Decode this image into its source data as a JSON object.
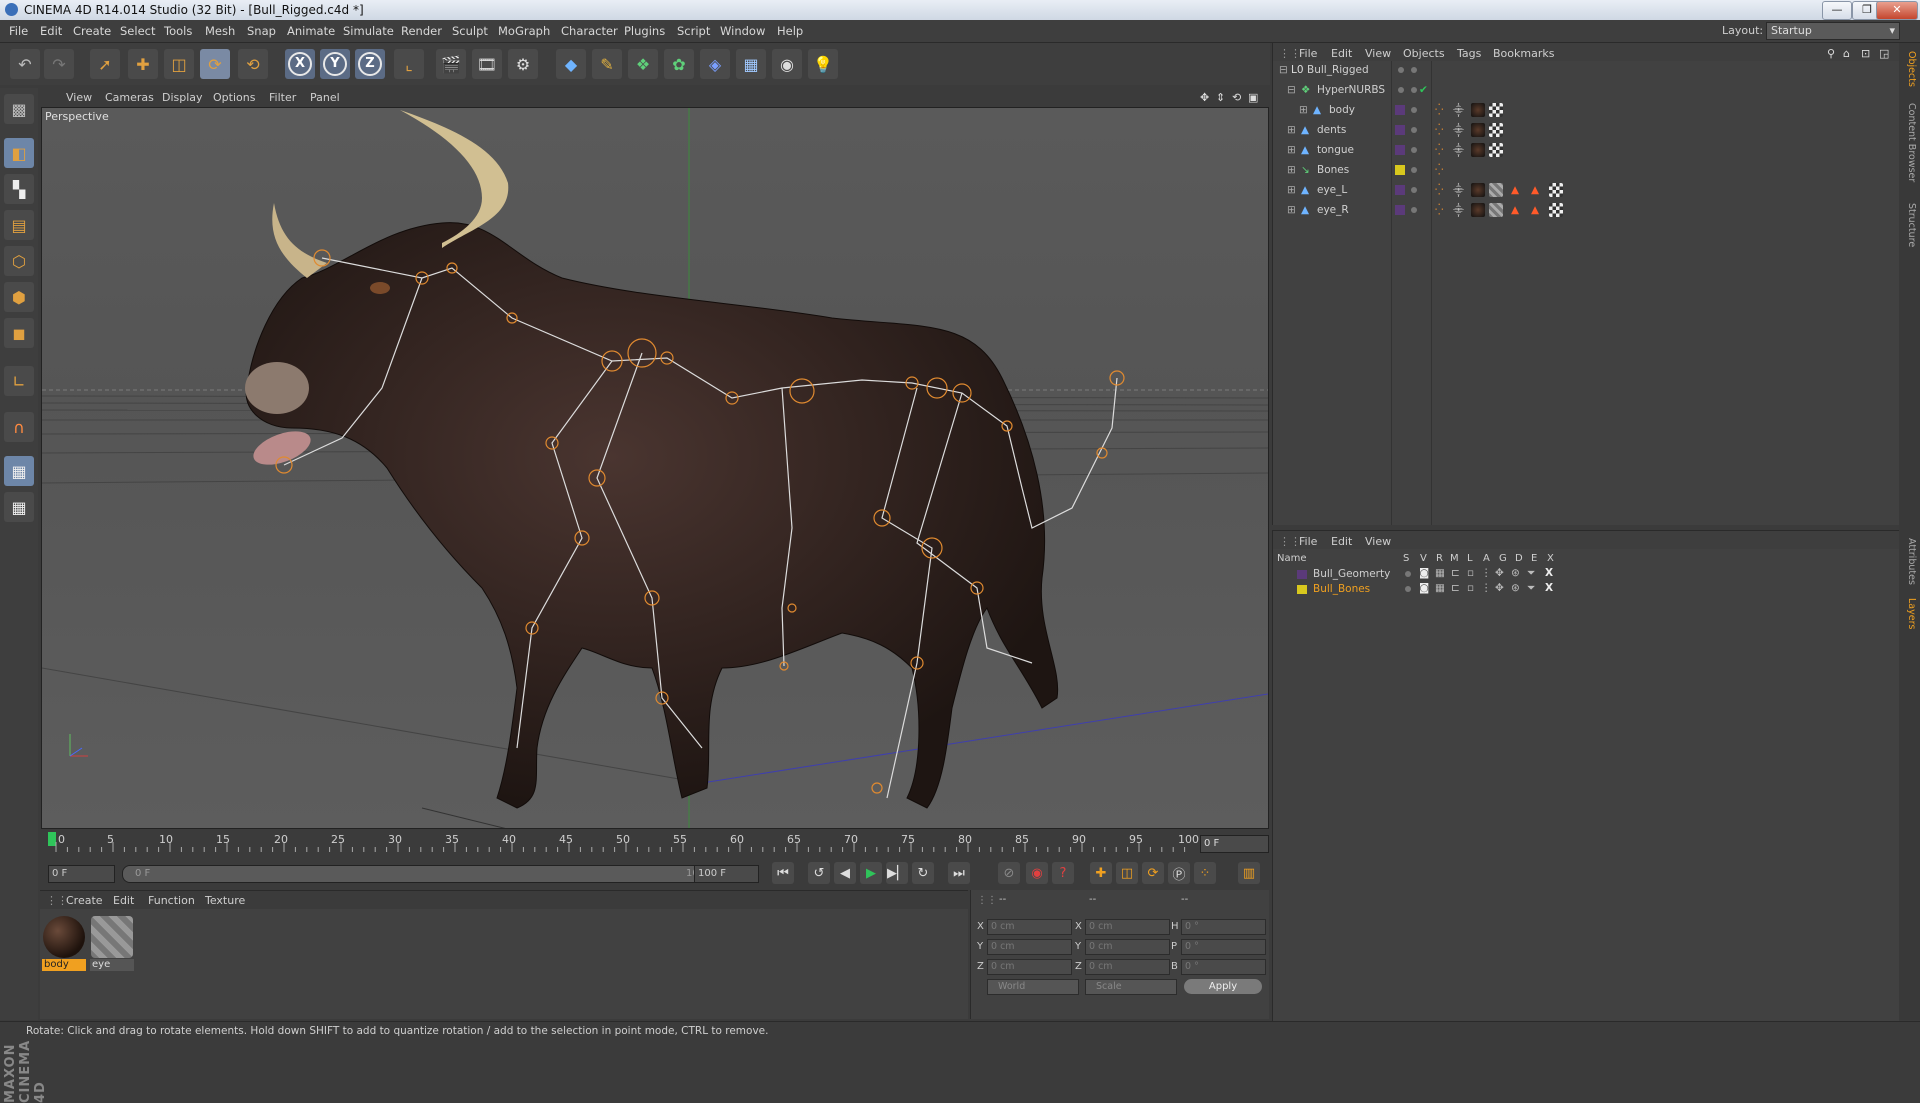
{
  "window": {
    "title": "CINEMA 4D R14.014 Studio (32 Bit) - [Bull_Rigged.c4d *]",
    "buttons": [
      "—",
      "❐",
      "✕"
    ]
  },
  "menu": [
    "File",
    "Edit",
    "Create",
    "Select",
    "Tools",
    "Mesh",
    "Snap",
    "Animate",
    "Simulate",
    "Render",
    "Sculpt",
    "MoGraph",
    "Character",
    "Plugins",
    "Script",
    "Window",
    "Help"
  ],
  "layout": {
    "label": "Layout:",
    "value": "Startup"
  },
  "viewport": {
    "menu": [
      "View",
      "Cameras",
      "Display",
      "Options",
      "Filter",
      "Panel"
    ],
    "camera_label": "Perspective"
  },
  "timeline": {
    "ticks": [
      "0",
      "5",
      "10",
      "15",
      "20",
      "25",
      "30",
      "35",
      "40",
      "45",
      "50",
      "55",
      "60",
      "65",
      "70",
      "75",
      "80",
      "85",
      "90",
      "95",
      "100"
    ],
    "current_frame": "0 F",
    "start_field": "0 F",
    "range_start": "0 F",
    "range_end": "100 F",
    "end_field": "100 F"
  },
  "materials": {
    "menu": [
      "Create",
      "Edit",
      "Function",
      "Texture"
    ],
    "items": [
      {
        "name": "body",
        "selected": true
      },
      {
        "name": "eye",
        "selected": false
      }
    ]
  },
  "coords": {
    "headers": [
      "--",
      "--",
      "--"
    ],
    "rows": [
      {
        "a": "X",
        "av": "0 cm",
        "b": "X",
        "bv": "0 cm",
        "c": "H",
        "cv": "0 °"
      },
      {
        "a": "Y",
        "av": "0 cm",
        "b": "Y",
        "bv": "0 cm",
        "c": "P",
        "cv": "0 °"
      },
      {
        "a": "Z",
        "av": "0 cm",
        "b": "Z",
        "bv": "0 cm",
        "c": "B",
        "cv": "0 °"
      }
    ],
    "mode1": "World",
    "mode2": "Scale",
    "apply": "Apply"
  },
  "status": "Rotate: Click and drag to rotate elements. Hold down SHIFT to add to quantize rotation / add to the selection in point mode, CTRL to remove.",
  "objects": {
    "menu": [
      "File",
      "Edit",
      "View",
      "Objects",
      "Tags",
      "Bookmarks"
    ],
    "rows": [
      {
        "name": "Bull_Rigged",
        "layer": "",
        "tags": []
      },
      {
        "name": "HyperNURBS",
        "layer": "",
        "tags": [
          "check"
        ]
      },
      {
        "name": "body",
        "layer": "#5b3a7a",
        "tags": [
          "weight",
          "bone",
          "mat",
          "uvw"
        ]
      },
      {
        "name": "dents",
        "layer": "#5b3a7a",
        "tags": [
          "weight",
          "bone",
          "mat",
          "uvw"
        ]
      },
      {
        "name": "tongue",
        "layer": "#5b3a7a",
        "tags": [
          "weight",
          "bone",
          "mat",
          "uvw"
        ]
      },
      {
        "name": "Bones",
        "layer": "#d8c81e",
        "tags": [
          "weight"
        ]
      },
      {
        "name": "eye_L",
        "layer": "#5b3a7a",
        "tags": [
          "weight",
          "bone",
          "mat",
          "mat2",
          "sel",
          "sel",
          "uvw"
        ]
      },
      {
        "name": "eye_R",
        "layer": "#5b3a7a",
        "tags": [
          "weight",
          "bone",
          "mat",
          "mat2",
          "sel",
          "sel",
          "uvw"
        ]
      }
    ]
  },
  "layers": {
    "menu": [
      "File",
      "Edit",
      "View"
    ],
    "headers": [
      "Name",
      "S",
      "V",
      "R",
      "M",
      "L",
      "A",
      "G",
      "D",
      "E",
      "X"
    ],
    "rows": [
      {
        "name": "Bull_Geomerty",
        "color": "#5b3a7a",
        "highlight": false
      },
      {
        "name": "Bull_Bones",
        "color": "#d8c81e",
        "highlight": true
      }
    ]
  },
  "sidetabs": [
    "Objects",
    "Content Browser",
    "Structure",
    "Attributes",
    "Layers"
  ],
  "colors": {
    "accent": "#f0a020",
    "selection": "#7a8aa4",
    "bone": "#e08a30"
  }
}
